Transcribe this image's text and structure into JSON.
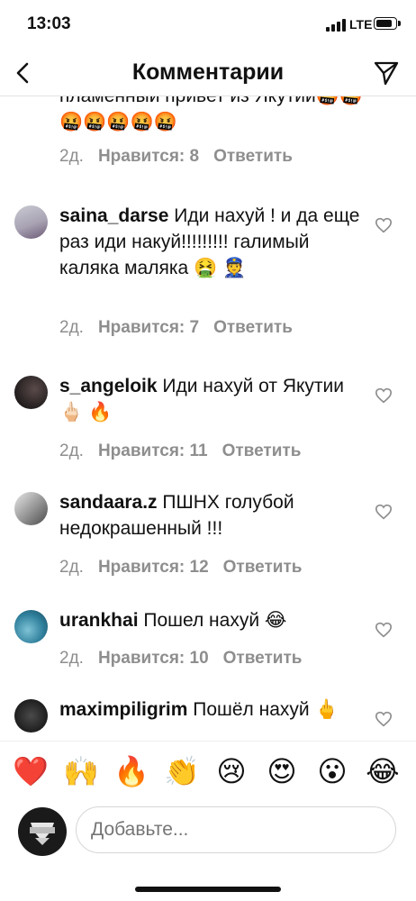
{
  "status": {
    "time": "13:03",
    "network": "LTE"
  },
  "nav": {
    "title": "Комментарии",
    "back_icon": "chevron-left-icon",
    "send_icon": "paper-plane-icon"
  },
  "top_comment": {
    "text": "пламенный привет из Якутии🤬🤬🤬🤬🤬🤬🤬",
    "age": "2д.",
    "likes": "Нравится: 8",
    "reply": "Ответить"
  },
  "comments": [
    {
      "user": "saina_darse",
      "text": " Иди нахуй ! и да еще раз иди накуй!!!!!!!!! галимый каляка маляка 🤮 👮",
      "age": "2д.",
      "likes": "Нравится: 7",
      "reply": "Ответить"
    },
    {
      "user": "s_angeloik",
      "text": " Иди нахуй от Якутии 🖕🏻 🔥",
      "age": "2д.",
      "likes": "Нравится: 11",
      "reply": "Ответить"
    },
    {
      "user": "sandaara.z",
      "text": " ПШНХ голубой недокрашенный !!!",
      "age": "2д.",
      "likes": "Нравится: 12",
      "reply": "Ответить"
    },
    {
      "user": "urankhai",
      "text": " Пошел нахуй 😂",
      "age": "2д.",
      "likes": "Нравится: 10",
      "reply": "Ответить"
    },
    {
      "user": "maximpiligrim",
      "text": " Пошёл нахуй 🖕",
      "age": "",
      "likes": "",
      "reply": ""
    }
  ],
  "emoji_bar": [
    "❤️",
    "🙌",
    "🔥",
    "👏",
    "😢",
    "😍",
    "😮",
    "😂"
  ],
  "composer": {
    "placeholder": "Добавьте..."
  },
  "colors": {
    "meta_gray": "#8e8e8e",
    "text": "#111111",
    "border": "#d6d6d6"
  }
}
